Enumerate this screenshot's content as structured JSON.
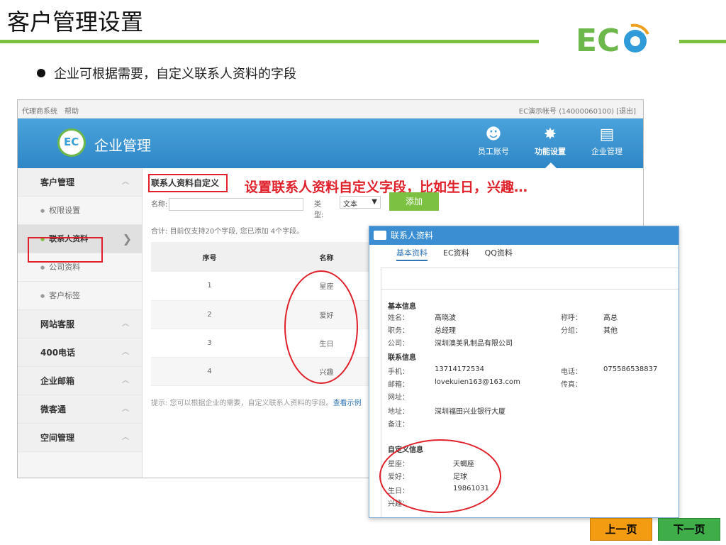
{
  "slide": {
    "title": "客户管理设置",
    "logo_text": "EC",
    "bullet": "企业可根据需要，自定义联系人资料的字段",
    "callout": "设置联系人资料自定义字段，比如生日，兴趣…",
    "prev_button": "上一页",
    "next_button": "下一页"
  },
  "app": {
    "topbar_left": [
      "代理商系统",
      "帮助"
    ],
    "topbar_right": "EC演示帐号 (14000060100) [退出]",
    "header_title": "企业管理",
    "logo_text": "EC",
    "nav": [
      {
        "label": "员工账号",
        "icon": "staff-icon"
      },
      {
        "label": "功能设置",
        "icon": "gear-icon"
      },
      {
        "label": "企业管理",
        "icon": "enterprise-icon"
      }
    ],
    "sidebar": [
      {
        "label": "客户管理",
        "type": "group"
      },
      {
        "label": "权限设置",
        "type": "sub"
      },
      {
        "label": "联系人资料",
        "type": "sub",
        "selected": true
      },
      {
        "label": "公司资料",
        "type": "sub"
      },
      {
        "label": "客户标签",
        "type": "sub"
      },
      {
        "label": "网站客服",
        "type": "group"
      },
      {
        "label": "400电话",
        "type": "group"
      },
      {
        "label": "企业邮箱",
        "type": "group"
      },
      {
        "label": "微客通",
        "type": "group"
      },
      {
        "label": "空间管理",
        "type": "group"
      }
    ],
    "content": {
      "title": "联系人资料自定义",
      "name_label": "名称:",
      "type_label": "类型:",
      "type_value": "文本",
      "add_button": "添加",
      "count_text": "合计: 目前仅支持20个字段, 您已添加 4个字段。",
      "table_headers": [
        "序号",
        "名称"
      ],
      "rows": [
        [
          "1",
          "星座"
        ],
        [
          "2",
          "爱好"
        ],
        [
          "3",
          "生日"
        ],
        [
          "4",
          "兴趣"
        ]
      ],
      "hint": "提示: 您可以根据企业的需要，自定义联系人资料的字段。",
      "hint_link": "查看示例"
    }
  },
  "popup": {
    "title": "联系人资料",
    "tabs": [
      "基本资料",
      "EC资料",
      "QQ资料"
    ],
    "sec_basic": "基本信息",
    "name_lbl": "姓名：",
    "name_val": "高晓波",
    "title_lbl": "称呼：",
    "title_val": "高总",
    "job_lbl": "职务：",
    "job_val": "总经理",
    "group_lbl": "分组：",
    "group_val": "其他",
    "company_lbl": "公司：",
    "company_val": "深圳澳美乳制品有限公司",
    "sec_contact": "联系信息",
    "mobile_lbl": "手机：",
    "mobile_val": "13714172534",
    "phone_lbl": "电话：",
    "phone_val": "075586538837",
    "email_lbl": "邮箱：",
    "email_val": "lovekuien163@163.com",
    "fax_lbl": "传真：",
    "web_lbl": "网址：",
    "addr_lbl": "地址：",
    "addr_val": "深圳福田兴业银行大厦",
    "note_lbl": "备注：",
    "sec_custom": "自定义信息",
    "star_lbl": "星座：",
    "star_val": "天蝎座",
    "hobby_lbl": "爱好：",
    "hobby_val": "足球",
    "bday_lbl": "生日：",
    "bday_val": "19861031",
    "interest_lbl": "兴趣："
  }
}
